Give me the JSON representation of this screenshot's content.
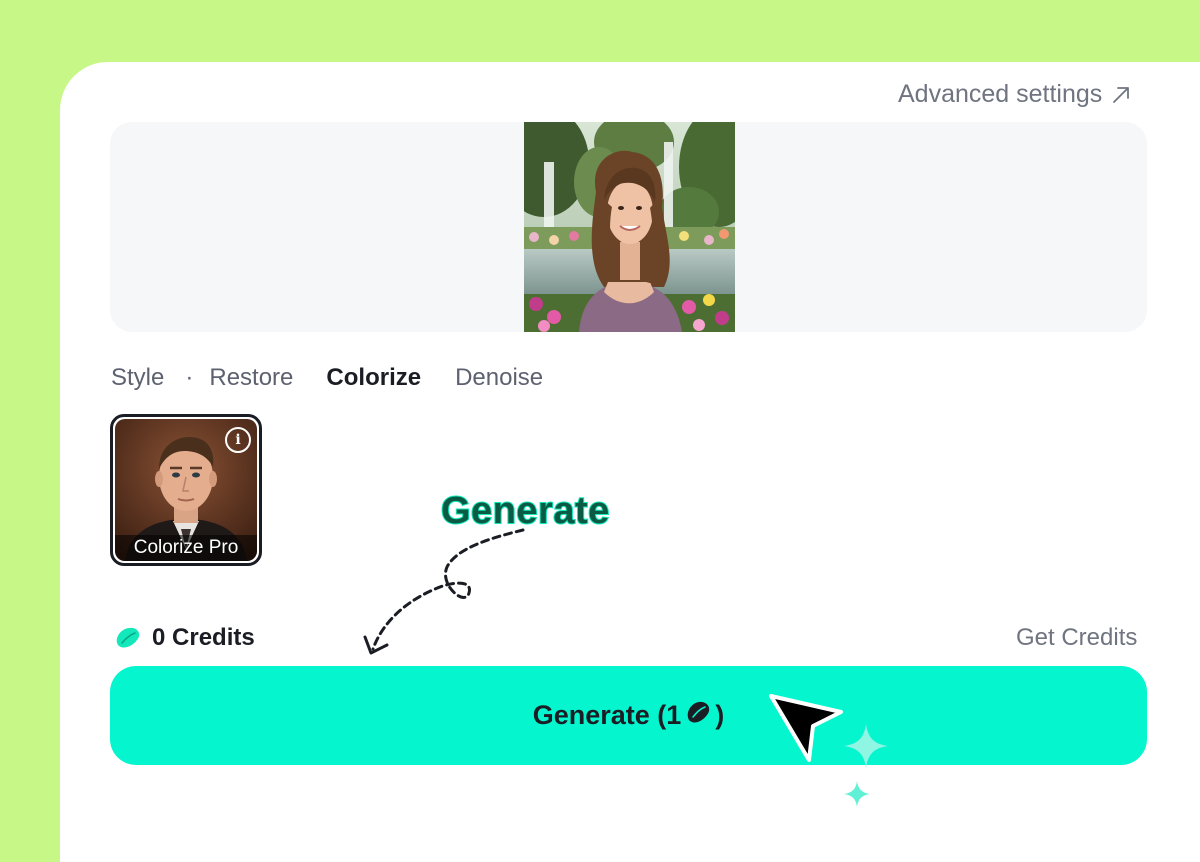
{
  "header": {
    "advanced_settings_label": "Advanced settings",
    "advanced_settings_icon": "arrow-up-right-icon"
  },
  "preview": {
    "image_desc": "portrait of smiling woman in a park with fountains and flowers"
  },
  "tabs": [
    {
      "label": "Style",
      "active": false
    },
    {
      "label": "Restore",
      "active": false
    },
    {
      "label": "Colorize",
      "active": true
    },
    {
      "label": "Denoise",
      "active": false
    }
  ],
  "tab_separator": "·",
  "styles": [
    {
      "label": "Colorize Pro",
      "info_icon": "info-icon",
      "selected": true
    }
  ],
  "annotation": {
    "label": "Generate"
  },
  "credits": {
    "count_label": "0 Credits",
    "get_credits_label": "Get Credits",
    "icon": "bean-icon"
  },
  "generate_button": {
    "label_prefix": "Generate (1",
    "label_suffix": ")",
    "icon": "bean-icon"
  },
  "colors": {
    "background": "#c6f787",
    "accent": "#05f5cf",
    "annotation": "#12e8ba",
    "text_dark": "#1b1d24",
    "text_muted": "#6f7480"
  }
}
